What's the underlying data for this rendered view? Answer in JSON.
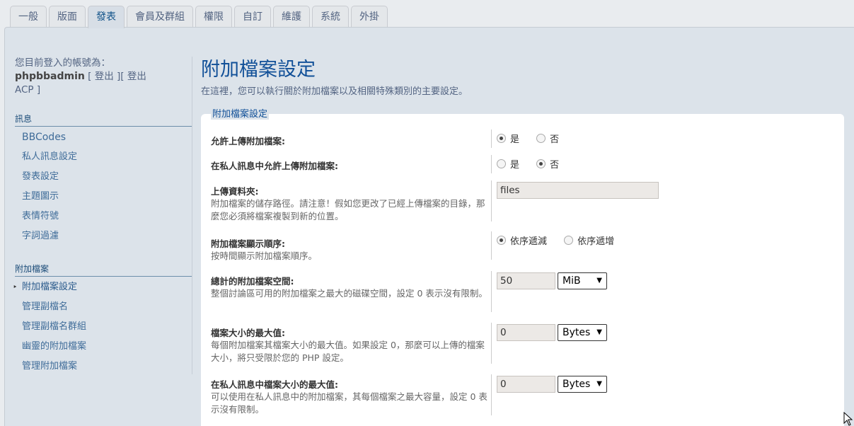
{
  "tabs": [
    {
      "label": "一般"
    },
    {
      "label": "版面"
    },
    {
      "label": "發表",
      "active": true
    },
    {
      "label": "會員及群組"
    },
    {
      "label": "權限"
    },
    {
      "label": "自訂"
    },
    {
      "label": "維護"
    },
    {
      "label": "系統"
    },
    {
      "label": "外掛"
    }
  ],
  "login": {
    "prefix": "您目前登入的帳號為：",
    "user": "phpbbadmin",
    "logout": "[ 登出 ]",
    "acp": "[ 登出 ACP ]"
  },
  "sidebar": {
    "sections": [
      {
        "title": "訊息",
        "items": [
          "BBCodes",
          "私人訊息設定",
          "發表設定",
          "主題圖示",
          "表情符號",
          "字詞過濾"
        ]
      },
      {
        "title": "附加檔案",
        "items": [
          "附加檔案設定",
          "管理副檔名",
          "管理副檔名群組",
          "幽靈的附加檔案",
          "管理附加檔案"
        ]
      }
    ],
    "active_item": "附加檔案設定"
  },
  "main": {
    "title": "附加檔案設定",
    "description": "在這裡，您可以執行關於附加檔案以及相關特殊類別的主要設定。",
    "legend": "附加檔案設定"
  },
  "settings": [
    {
      "label": "允許上傳附加檔案:",
      "desc": "",
      "type": "radio",
      "options": [
        "是",
        "否"
      ],
      "selected": "是"
    },
    {
      "label": "在私人訊息中允許上傳附加檔案:",
      "desc": "",
      "type": "radio",
      "options": [
        "是",
        "否"
      ],
      "selected": "否"
    },
    {
      "label": "上傳資料夾:",
      "desc": "附加檔案的儲存路徑。請注意！假如您更改了已經上傳檔案的目錄，那麼您必須將檔案複製到新的位置。",
      "type": "text",
      "value": "files"
    },
    {
      "label": "附加檔案顯示順序:",
      "desc": "按時間顯示附加檔案順序。",
      "type": "radio",
      "options": [
        "依序遞減",
        "依序遞增"
      ],
      "selected": "依序遞減"
    },
    {
      "label": "總計的附加檔案空間:",
      "desc": "整個討論區可用的附加檔案之最大的磁碟空間，設定 0 表示沒有限制。",
      "type": "text_select",
      "value": "50",
      "unit": "MiB"
    },
    {
      "label": "檔案大小的最大值:",
      "desc": "每個附加檔案其檔案大小的最大值。如果設定 0，那麼可以上傳的檔案大小，將只受限於您的 PHP 設定。",
      "type": "text_select",
      "value": "0",
      "unit": "Bytes"
    },
    {
      "label": "在私人訊息中檔案大小的最大值:",
      "desc": "可以使用在私人訊息中的附加檔案，其每個檔案之最大容量，設定 0 表示沒有限制。",
      "type": "text_select",
      "value": "0",
      "unit": "Bytes"
    }
  ]
}
